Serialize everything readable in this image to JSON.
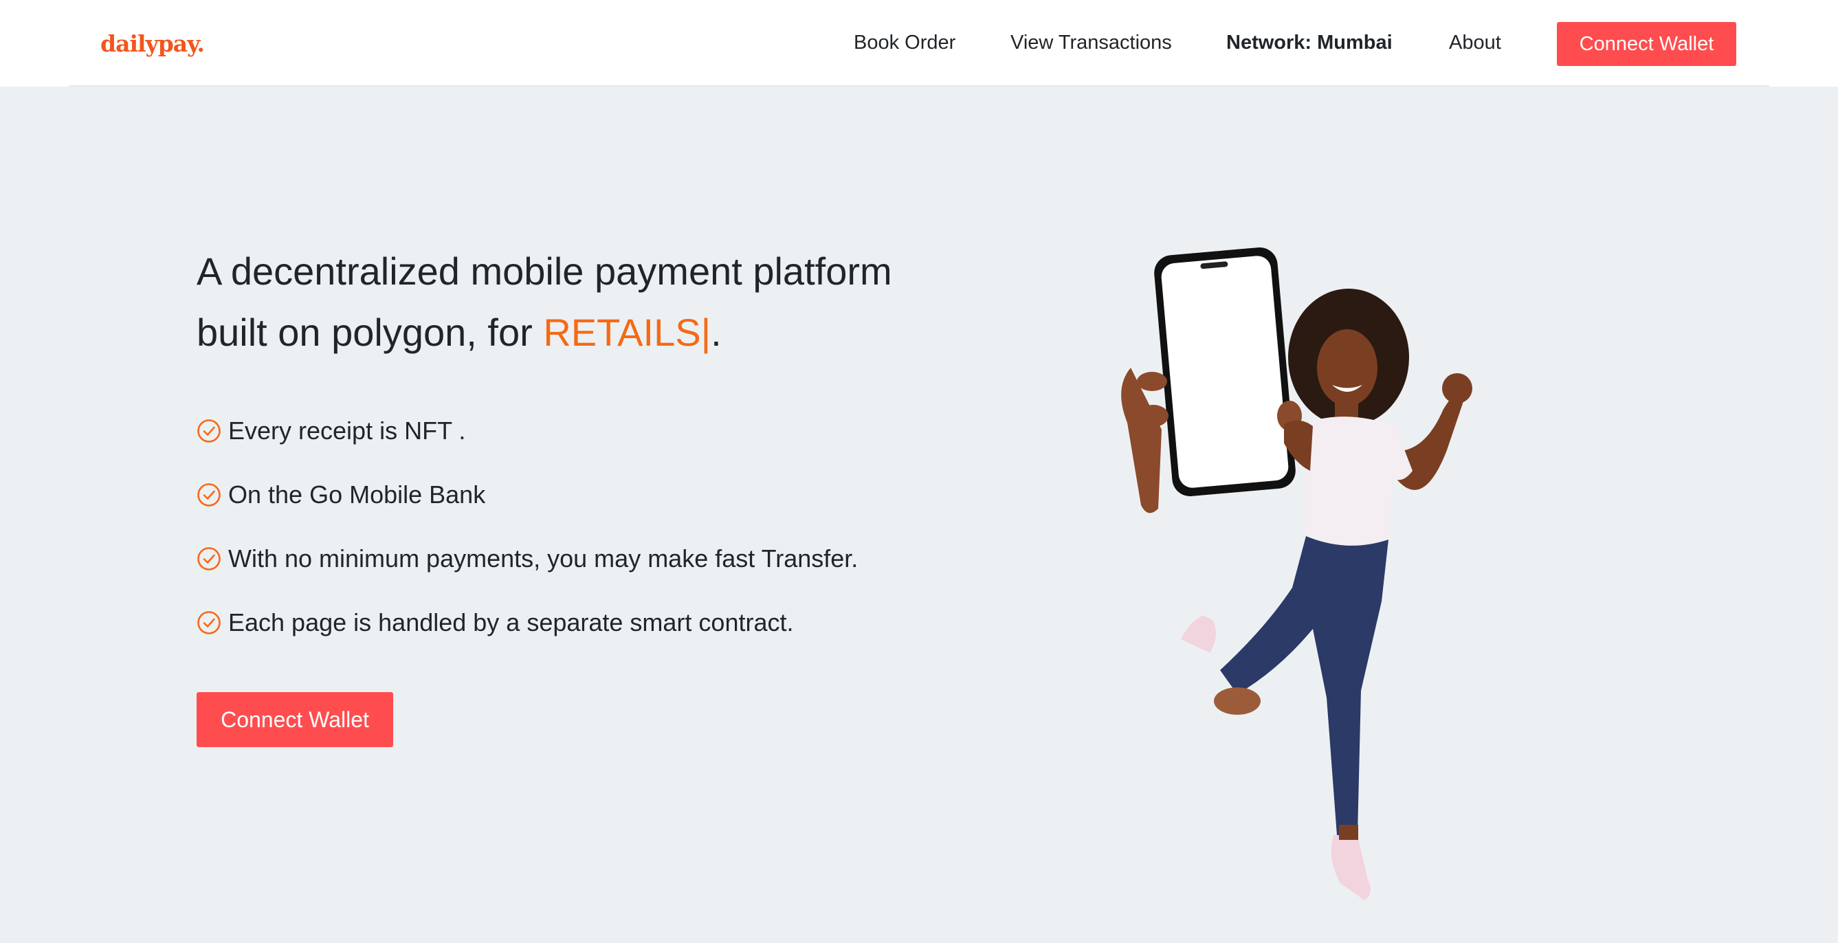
{
  "brand": {
    "logo_text": "dailypay.",
    "color": "#f2561d"
  },
  "nav": {
    "items": [
      {
        "label": "Book Order"
      },
      {
        "label": "View Transactions"
      },
      {
        "label": "Network: Mumbai"
      },
      {
        "label": "About"
      }
    ],
    "connect_label": "Connect Wallet"
  },
  "hero": {
    "title_part1": "A decentralized mobile payment platform",
    "title_part2": "built on polygon, for ",
    "accent_word": "RETAILS|",
    "title_end": ".",
    "features": [
      {
        "text": "Every receipt is NFT .",
        "icon": "check-circle-icon"
      },
      {
        "text": "On the Go Mobile Bank",
        "icon": "check-circle-icon"
      },
      {
        "text": "With no minimum payments, you may make fast Transfer.",
        "icon": "check-circle-icon"
      },
      {
        "text": "Each page is handled by a separate smart contract.",
        "icon": "check-circle-icon"
      }
    ],
    "cta_label": "Connect Wallet"
  },
  "colors": {
    "accent_orange": "#f56a16",
    "button_red": "#ff4d4f",
    "background": "#edf0f3"
  }
}
